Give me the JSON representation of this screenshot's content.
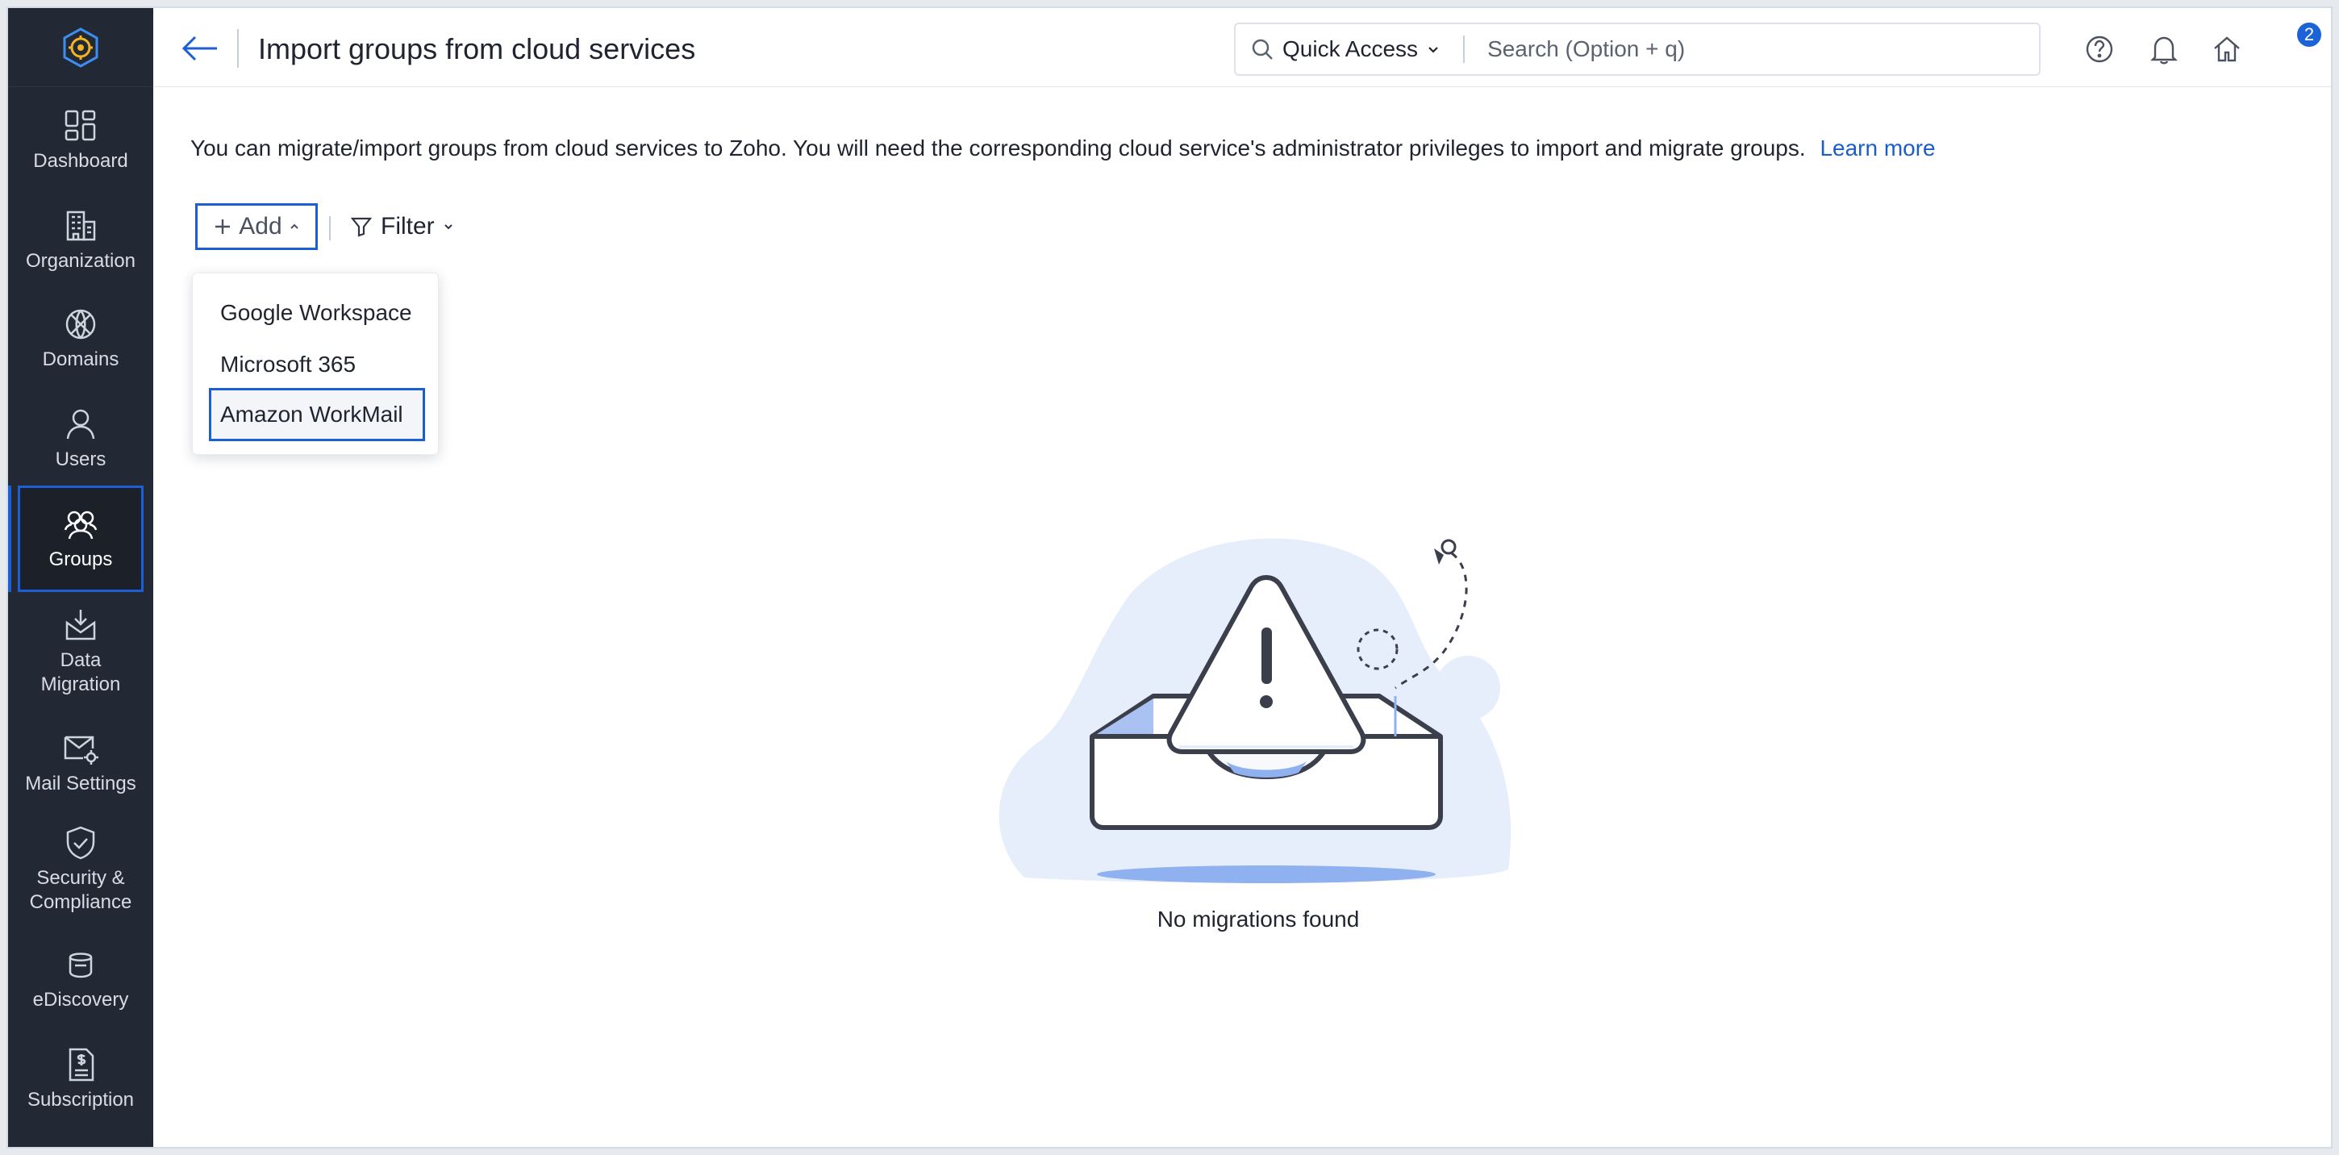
{
  "header": {
    "title": "Import groups from cloud services",
    "quick_access_label": "Quick Access",
    "search_placeholder": "Search (Option + q)",
    "notification_count": "2"
  },
  "sidebar": {
    "items": [
      {
        "label": "Dashboard",
        "icon": "dashboard-icon"
      },
      {
        "label": "Organization",
        "icon": "organization-icon"
      },
      {
        "label": "Domains",
        "icon": "domains-icon"
      },
      {
        "label": "Users",
        "icon": "user-icon"
      },
      {
        "label": "Groups",
        "icon": "groups-icon",
        "active": true
      },
      {
        "label": "Data Migration",
        "icon": "data-migration-icon"
      },
      {
        "label": "Mail Settings",
        "icon": "mail-settings-icon"
      },
      {
        "label": "Security & Compliance",
        "icon": "security-shield-icon"
      },
      {
        "label": "eDiscovery",
        "icon": "ediscovery-icon"
      },
      {
        "label": "Subscription",
        "icon": "subscription-icon"
      }
    ]
  },
  "main": {
    "intro_text": "You can migrate/import groups from cloud services to Zoho. You will need the corresponding cloud service's administrator privileges to import and migrate groups.",
    "learn_more": "Learn more",
    "add_label": "Add",
    "filter_label": "Filter",
    "dropdown_items": [
      "Google Workspace",
      "Microsoft 365",
      "Amazon WorkMail"
    ],
    "empty_message": "No migrations found"
  },
  "colors": {
    "accent": "#1c5fd4",
    "sidebar_bg": "#232934",
    "link": "#1a5ec9",
    "illustration_blue": "#e6eefb"
  }
}
